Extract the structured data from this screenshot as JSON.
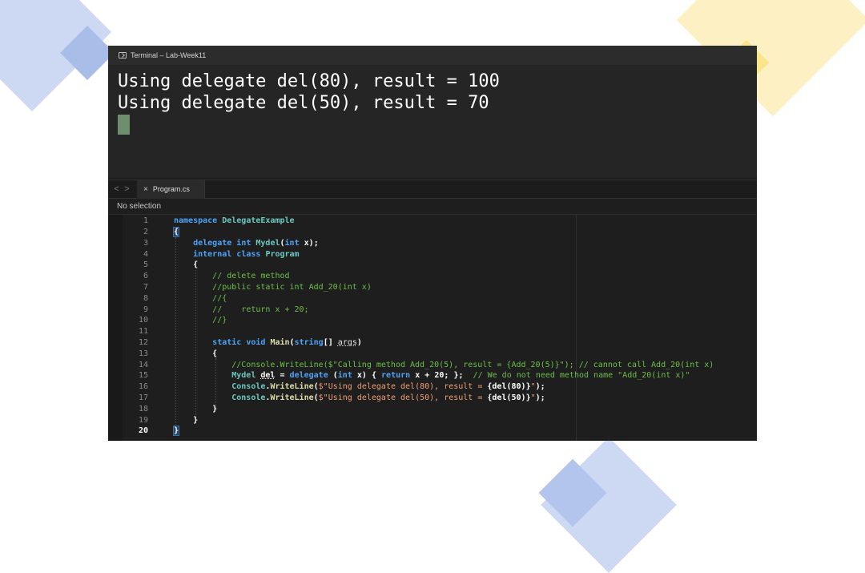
{
  "terminal": {
    "title": "Terminal – Lab-Week11",
    "output": [
      "Using delegate del(80), result = 100",
      "Using delegate del(50), result = 70"
    ]
  },
  "editor": {
    "nav_back": "<",
    "nav_forward": ">",
    "tab_close": "×",
    "tab_label": "Program.cs",
    "selection_status": "No selection",
    "line_numbers": [
      "1",
      "2",
      "3",
      "4",
      "5",
      "6",
      "7",
      "8",
      "9",
      "10",
      "11",
      "12",
      "13",
      "14",
      "15",
      "16",
      "17",
      "18",
      "19",
      "20"
    ],
    "active_line": "20",
    "code_lines": [
      "namespace DelegateExample",
      "{",
      "    delegate int Mydel(int x);",
      "    internal class Program",
      "    {",
      "        // delete method",
      "        //public static int Add_20(int x)",
      "        //{",
      "        //    return x + 20;",
      "        //}",
      "",
      "        static void Main(string[] args)",
      "        {",
      "            //Console.WriteLine($\"Calling method Add_20(5), result = {Add_20(5)}\"); // cannot call Add_20(int x)",
      "            Mydel del = delegate (int x) { return x + 20; };  // We do not need method name \"Add_20(int x)\"",
      "            Console.WriteLine($\"Using delegate del(80), result = {del(80)}\");",
      "            Console.WriteLine($\"Using delegate del(50), result = {del(50)}\");",
      "        }",
      "    }",
      "}"
    ]
  }
}
